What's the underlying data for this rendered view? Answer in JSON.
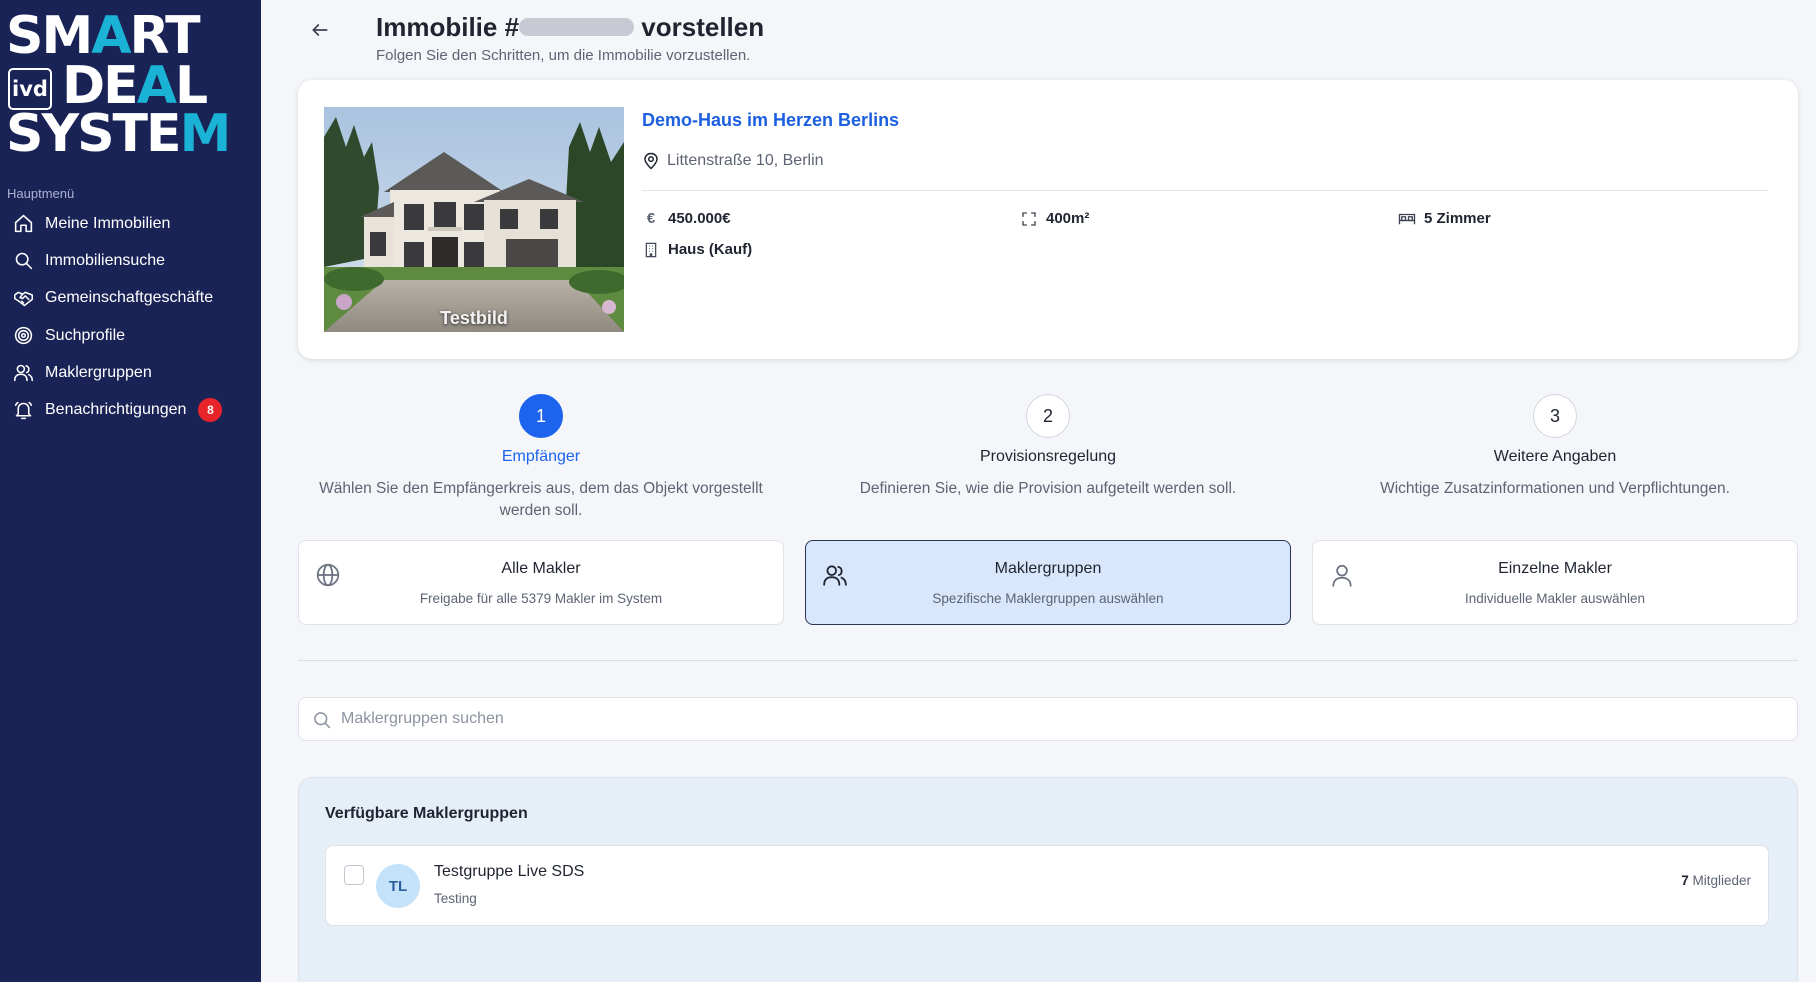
{
  "brand": {
    "logo_line1": "SMART",
    "logo_line2": "DEAL",
    "logo_line3": "SYSTEM",
    "logo_badge": "ivd",
    "accent_color": "#1ab3d6",
    "sidebar_color": "#1a2356"
  },
  "sidebar": {
    "heading": "Hauptmenü",
    "items": [
      {
        "label": "Meine Immobilien",
        "icon": "home-icon"
      },
      {
        "label": "Immobiliensuche",
        "icon": "search-icon"
      },
      {
        "label": "Gemeinschaftgeschäfte",
        "icon": "handshake-icon"
      },
      {
        "label": "Suchprofile",
        "icon": "target-icon"
      },
      {
        "label": "Maklergruppen",
        "icon": "users-icon"
      },
      {
        "label": "Benachrichtigungen",
        "icon": "bell-icon",
        "badge": "8"
      }
    ]
  },
  "header": {
    "title_prefix": "Immobilie #",
    "title_suffix": "vorstellen",
    "subtitle": "Folgen Sie den Schritten, um die Immobilie vorzustellen."
  },
  "property": {
    "image_caption": "Testbild",
    "title": "Demo-Haus im Herzen Berlins",
    "address": "Littenstraße 10, Berlin",
    "price": "450.000€",
    "area": "400m²",
    "rooms": "5 Zimmer",
    "type": "Haus (Kauf)",
    "price_icon": "€"
  },
  "steps": [
    {
      "number": "1",
      "label": "Empfänger",
      "description_line1": "Wählen Sie den Empfängerkreis aus, dem das Objekt vorgestellt",
      "description_line2": "werden soll.",
      "active": true
    },
    {
      "number": "2",
      "label": "Provisionsregelung",
      "description_line1": "Definieren Sie, wie die Provision aufgeteilt werden soll.",
      "description_line2": "",
      "active": false
    },
    {
      "number": "3",
      "label": "Weitere Angaben",
      "description_line1": "Wichtige Zusatzinformationen und Verpflichtungen.",
      "description_line2": "",
      "active": false
    }
  ],
  "recipient_options": [
    {
      "title": "Alle Makler",
      "subtitle": "Freigabe für alle 5379 Makler im System",
      "icon": "globe-icon",
      "selected": false
    },
    {
      "title": "Maklergruppen",
      "subtitle": "Spezifische Maklergruppen auswählen",
      "icon": "users-icon",
      "selected": true
    },
    {
      "title": "Einzelne Makler",
      "subtitle": "Individuelle Makler auswählen",
      "icon": "user-icon",
      "selected": false
    }
  ],
  "group_search": {
    "placeholder": "Maklergruppen suchen",
    "value": ""
  },
  "available_groups": {
    "heading": "Verfügbare Maklergruppen",
    "groups": [
      {
        "initials": "TL",
        "name": "Testgruppe Live SDS",
        "description": "Testing",
        "member_count": "7",
        "member_label": "Mitglieder",
        "checked": false
      }
    ]
  }
}
